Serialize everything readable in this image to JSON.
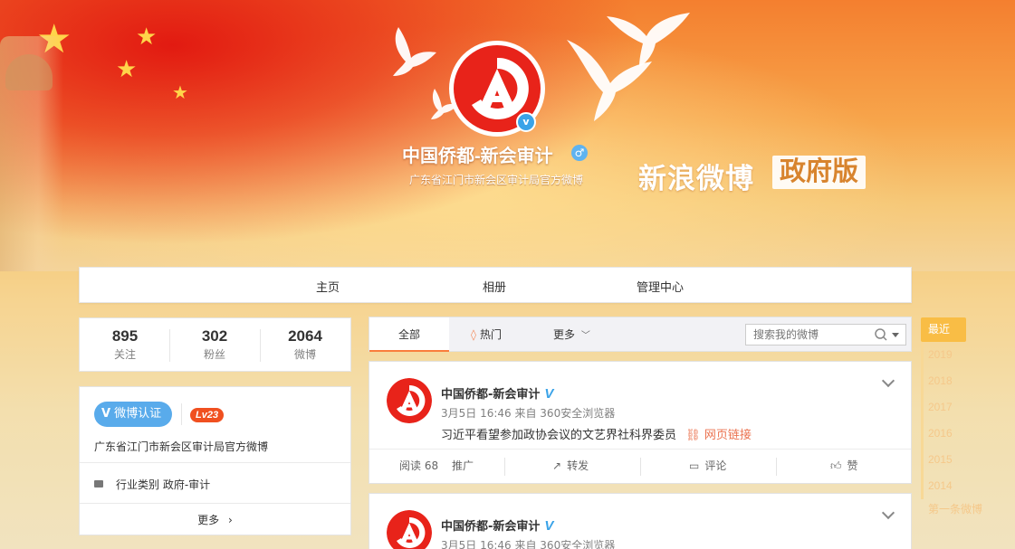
{
  "profile": {
    "name": "中国侨都-新会审计",
    "description": "广东省江门市新会区审计局官方微博",
    "verified_mark": "v",
    "gender_symbol": "♂"
  },
  "brand": {
    "text": "新浪微博",
    "badge": "政府版"
  },
  "nav": {
    "items": [
      "主页",
      "相册",
      "管理中心"
    ]
  },
  "stats": [
    {
      "value": "895",
      "label": "关注"
    },
    {
      "value": "302",
      "label": "粉丝"
    },
    {
      "value": "2064",
      "label": "微博"
    }
  ],
  "info": {
    "verify_label": "微博认证",
    "verify_mark": "V",
    "level": "Lv23",
    "description": "广东省江门市新会区审计局官方微博",
    "industry_label": "行业类别",
    "industry_value": "政府-审计",
    "more": "更多"
  },
  "feed_tabs": {
    "all": "全部",
    "hot": "热门",
    "more": "更多",
    "search_placeholder": "搜索我的微博"
  },
  "posts": [
    {
      "author": "中国侨都-新会审计",
      "verified": "V",
      "meta": "3月5日 16:46 来自 360安全浏览器",
      "text": "习近平看望参加政协会议的文艺界社科界委员",
      "link_text": "网页链接",
      "actions": {
        "reads": "阅读 68",
        "promote": "推广",
        "repost": "转发",
        "comment": "评论",
        "like": "赞"
      }
    },
    {
      "author": "中国侨都-新会审计",
      "verified": "V",
      "meta": "3月5日 16:46 来自 360安全浏览器"
    }
  ],
  "timeline": {
    "recent": "最近",
    "years": [
      "2019",
      "2018",
      "2017",
      "2016",
      "2015",
      "2014"
    ],
    "first": "第一条微博"
  },
  "colors": {
    "accent": "#fa7d3c",
    "verify_blue": "#59abeb",
    "logo_red": "#e8231a",
    "timeline_gold": "#f9bd45"
  }
}
